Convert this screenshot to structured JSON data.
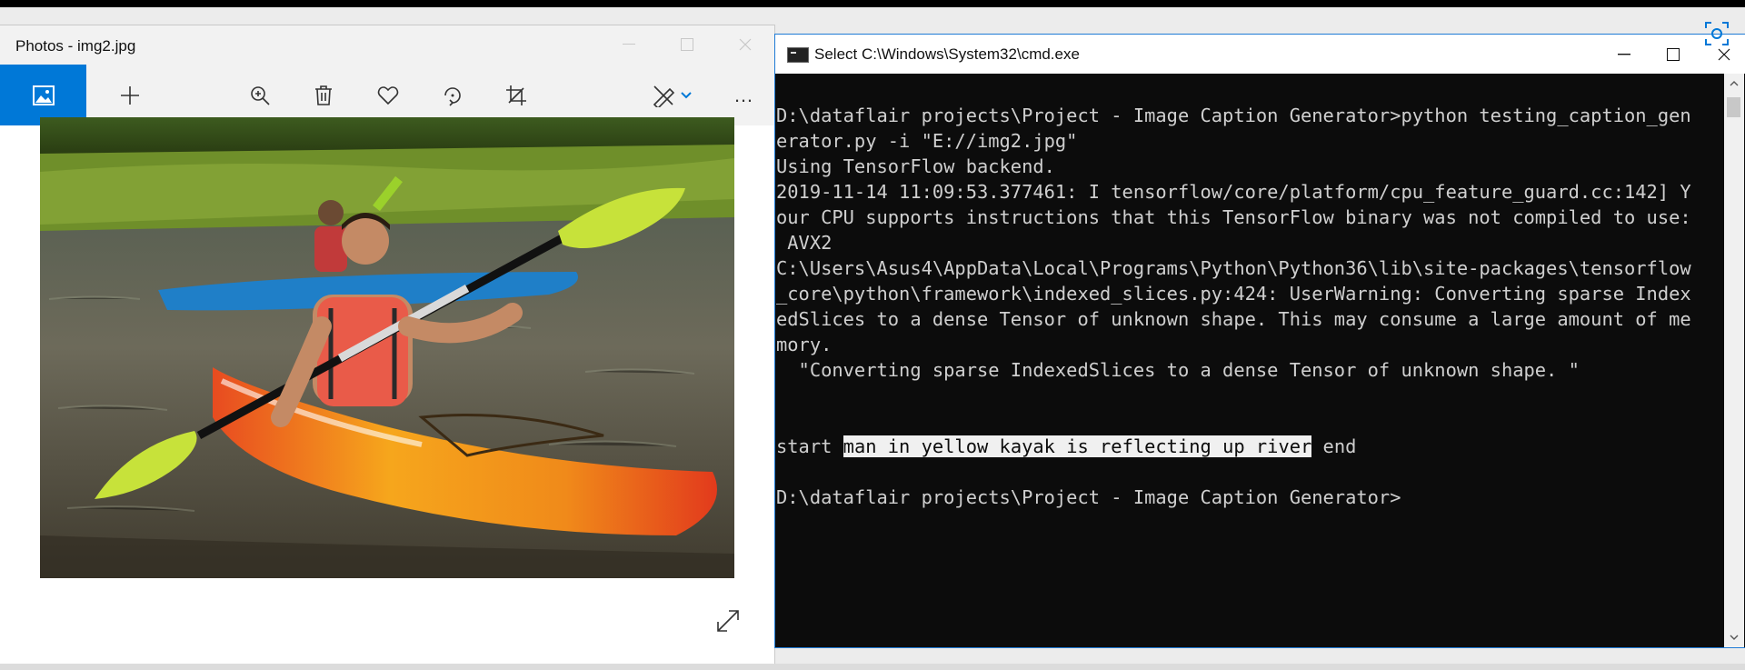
{
  "photos": {
    "title": "Photos - img2.jpg",
    "toolbar": {
      "icons": [
        "image-icon",
        "add-icon",
        "zoom-in-icon",
        "delete-icon",
        "heart-icon",
        "rotate-icon",
        "crop-icon",
        "edit-icon",
        "more-icon"
      ],
      "more_label": "…"
    },
    "image_description": "kayak-photo"
  },
  "cmd": {
    "title": "Select C:\\Windows\\System32\\cmd.exe",
    "lines": [
      "",
      "D:\\dataflair projects\\Project - Image Caption Generator>python testing_caption_gen",
      "erator.py -i \"E://img2.jpg\"",
      "Using TensorFlow backend.",
      "2019-11-14 11:09:53.377461: I tensorflow/core/platform/cpu_feature_guard.cc:142] Y",
      "our CPU supports instructions that this TensorFlow binary was not compiled to use:",
      " AVX2",
      "C:\\Users\\Asus4\\AppData\\Local\\Programs\\Python\\Python36\\lib\\site-packages\\tensorflow",
      "_core\\python\\framework\\indexed_slices.py:424: UserWarning: Converting sparse Index",
      "edSlices to a dense Tensor of unknown shape. This may consume a large amount of me",
      "mory.",
      "  \"Converting sparse IndexedSlices to a dense Tensor of unknown shape. \"",
      "",
      "",
      "",
      "",
      "D:\\dataflair projects\\Project - Image Caption Generator>"
    ],
    "result": {
      "prefix": "start ",
      "selected": "man in yellow kayak is reflecting up river",
      "suffix": " end"
    }
  },
  "colors": {
    "accent": "#0078d7",
    "console_bg": "#0c0c0c",
    "console_text": "#cfcfcf"
  }
}
